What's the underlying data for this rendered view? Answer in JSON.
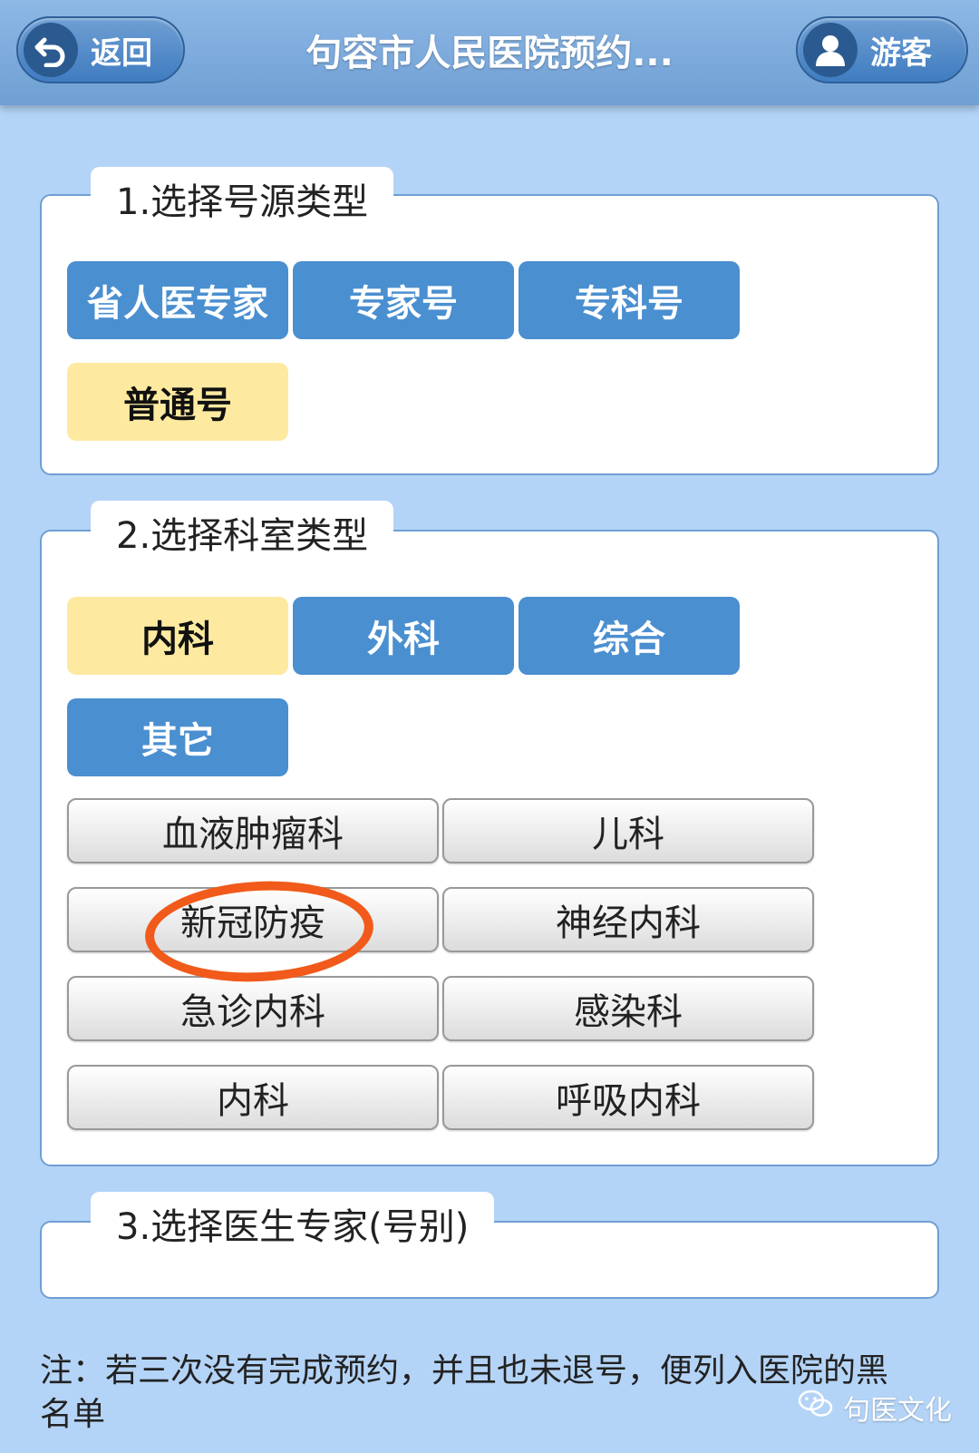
{
  "header": {
    "back_label": "返回",
    "title": "句容市人民医院预约...",
    "user_label": "游客"
  },
  "sections": {
    "source_type": {
      "title": "1.选择号源类型",
      "options": [
        "省人医专家",
        "专家号",
        "专科号",
        "普通号"
      ],
      "selected": "普通号"
    },
    "department_type": {
      "title": "2.选择科室类型",
      "options": [
        "内科",
        "外科",
        "综合",
        "其它"
      ],
      "selected": "内科",
      "departments": [
        "血液肿瘤科",
        "儿科",
        "新冠防疫",
        "神经内科",
        "急诊内科",
        "感染科",
        "内科",
        "呼吸内科"
      ]
    },
    "doctor": {
      "title": "3.选择医生专家(号别)"
    }
  },
  "note": "注：若三次没有完成预约，并且也未退号，便列入医院的黑名单",
  "watermark": "句医文化",
  "colors": {
    "header": "#7aaad9",
    "tile_blue": "#4a8fd0",
    "tile_selected": "#fdeaa0",
    "background": "#b4d4f7",
    "annotation": "#f15a1a"
  }
}
